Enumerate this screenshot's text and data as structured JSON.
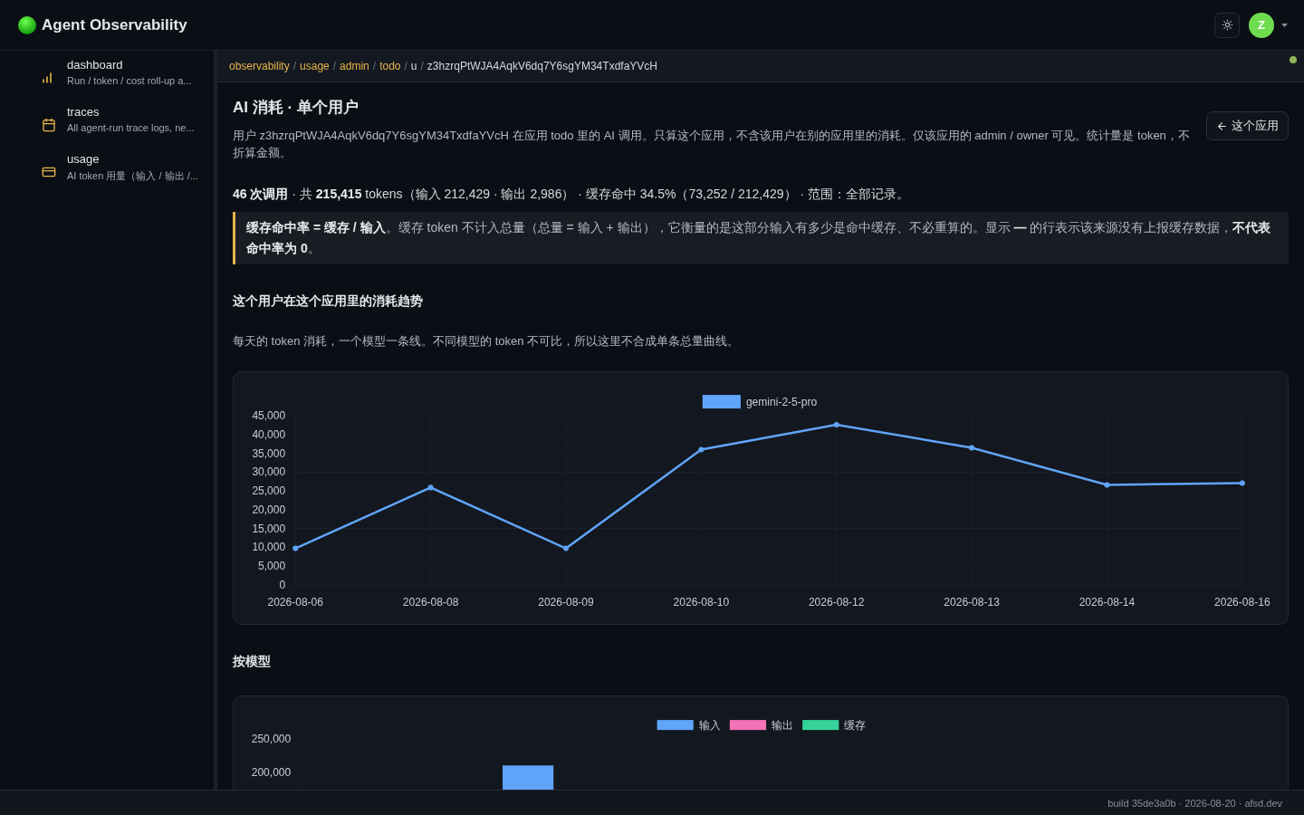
{
  "app": {
    "title": "Agent Observability"
  },
  "header": {
    "avatar": "Z"
  },
  "sidebar": {
    "items": [
      {
        "kind": "chart",
        "title": "dashboard",
        "subtitle": "Run / token / cost roll-up a..."
      },
      {
        "kind": "calendar",
        "title": "traces",
        "subtitle": "All agent-run trace logs, ne..."
      },
      {
        "kind": "card",
        "title": "usage",
        "subtitle": "AI token 用量（输入 / 输出 /..."
      }
    ]
  },
  "breadcrumb": {
    "items": [
      {
        "kind": "link",
        "text": "observability"
      },
      {
        "kind": "separator",
        "text": "/"
      },
      {
        "kind": "link",
        "text": "usage"
      },
      {
        "kind": "separator",
        "text": "/"
      },
      {
        "kind": "link",
        "text": "admin"
      },
      {
        "kind": "separator",
        "text": "/"
      },
      {
        "kind": "link",
        "text": "todo"
      },
      {
        "kind": "separator",
        "text": "/"
      },
      {
        "kind": "text",
        "text": "u"
      },
      {
        "kind": "separator",
        "text": "/"
      },
      {
        "kind": "text",
        "text": "z3hzrqPtWJA4AqkV6dq7Y6sgYM34TxdfaYVcH"
      }
    ],
    "status_dot": {
      "color": "#8fb35a"
    }
  },
  "page": {
    "title": "AI 消耗 · 单个用户",
    "description": "用户 z3hzrqPtWJA4AqkV6dq7Y6sgYM34TxdfaYVcH 在应用 todo 里的 AI 调用。只算这个应用，不含该用户在别的应用里的消耗。仅该应用的 admin / owner 可见。统计量是 token，不折算金额。",
    "back_button": "这个应用",
    "summary": "**46 次调用** · 共 **215,415** tokens（输入 212,429 · 输出 2,986） · 缓存命中 34.5%（73,252 / 212,429） · 范围：全部记录。",
    "note": "**缓存命中率 = 缓存 / 输入**。缓存 token 不计入总量（总量 = 输入 + 输出），它衡量的是这部分输入有多少是命中缓存、不必重算的。显示 **—** 的行表示该来源没有上报缓存数据，**不代表命中率为 0**。"
  },
  "trend": {
    "heading": "这个用户在这个应用里的消耗趋势",
    "caption": "每天的 token 消耗，一个模型一条线。不同模型的 token 不可比，所以这里不合成单条总量曲线。",
    "chart_data": {
      "type": "line",
      "categories": [
        "2026-08-06",
        "2026-08-08",
        "2026-08-09",
        "2026-08-10",
        "2026-08-12",
        "2026-08-13",
        "2026-08-14",
        "2026-08-16"
      ],
      "series": [
        {
          "name": "gemini-2-5-pro",
          "color": "#60a5fa",
          "marker": "circle",
          "values": [
            9700,
            25900,
            9700,
            36000,
            42600,
            36500,
            26600,
            27100
          ]
        }
      ],
      "grid": true,
      "ylim": [
        0,
        45000
      ],
      "yticks": [
        {
          "value": 0,
          "label": "0"
        },
        {
          "value": 5000,
          "label": "5,000"
        },
        {
          "value": 10000,
          "label": "10,000"
        },
        {
          "value": 15000,
          "label": "15,000"
        },
        {
          "value": 20000,
          "label": "20,000"
        },
        {
          "value": 25000,
          "label": "25,000"
        },
        {
          "value": 30000,
          "label": "30,000"
        },
        {
          "value": 35000,
          "label": "35,000"
        },
        {
          "value": 40000,
          "label": "40,000"
        },
        {
          "value": 45000,
          "label": "45,000"
        }
      ]
    }
  },
  "by_model": {
    "heading": "按模型",
    "chart": {
      "legend": [
        {
          "label": "输入",
          "color": "#60a5fa"
        },
        {
          "label": "输出",
          "color": "#f472b6"
        },
        {
          "label": "缓存",
          "color": "#34d399"
        }
      ],
      "y_axis_labels": [
        "250,000",
        "200,000"
      ]
    }
  },
  "footer": "build 35de3a0b · 2026-08-20 · afsd.dev"
}
